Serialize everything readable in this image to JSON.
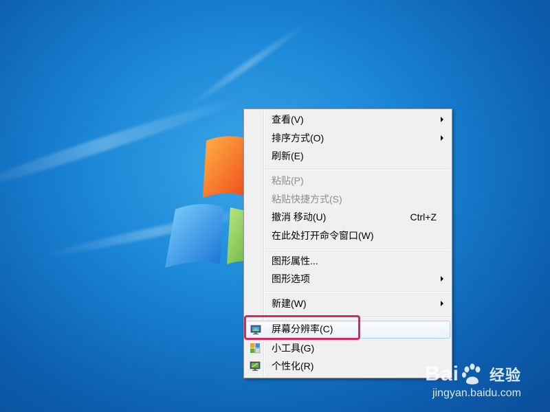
{
  "menu": {
    "items": [
      {
        "label": "查看(V)",
        "has_submenu": true
      },
      {
        "label": "排序方式(O)",
        "has_submenu": true
      },
      {
        "label": "刷新(E)"
      },
      {
        "label": "粘贴(P)",
        "disabled": true
      },
      {
        "label": "粘贴快捷方式(S)",
        "disabled": true
      },
      {
        "label": "撤消 移动(U)",
        "shortcut": "Ctrl+Z"
      },
      {
        "label": "在此处打开命令窗口(W)"
      },
      {
        "label": "图形属性..."
      },
      {
        "label": "图形选项",
        "has_submenu": true
      },
      {
        "label": "新建(W)",
        "has_submenu": true
      },
      {
        "label": "屏幕分辨率(C)",
        "icon": "monitor-icon",
        "hovered": true
      },
      {
        "label": "小工具(G)",
        "icon": "gadgets-icon"
      },
      {
        "label": "个性化(R)",
        "icon": "personalize-icon"
      }
    ]
  },
  "annotation": {
    "color": "#e0245d"
  },
  "watermark": {
    "brand_left": "Bai",
    "brand_right": "经验",
    "url": "jingyan.baidu.com"
  }
}
